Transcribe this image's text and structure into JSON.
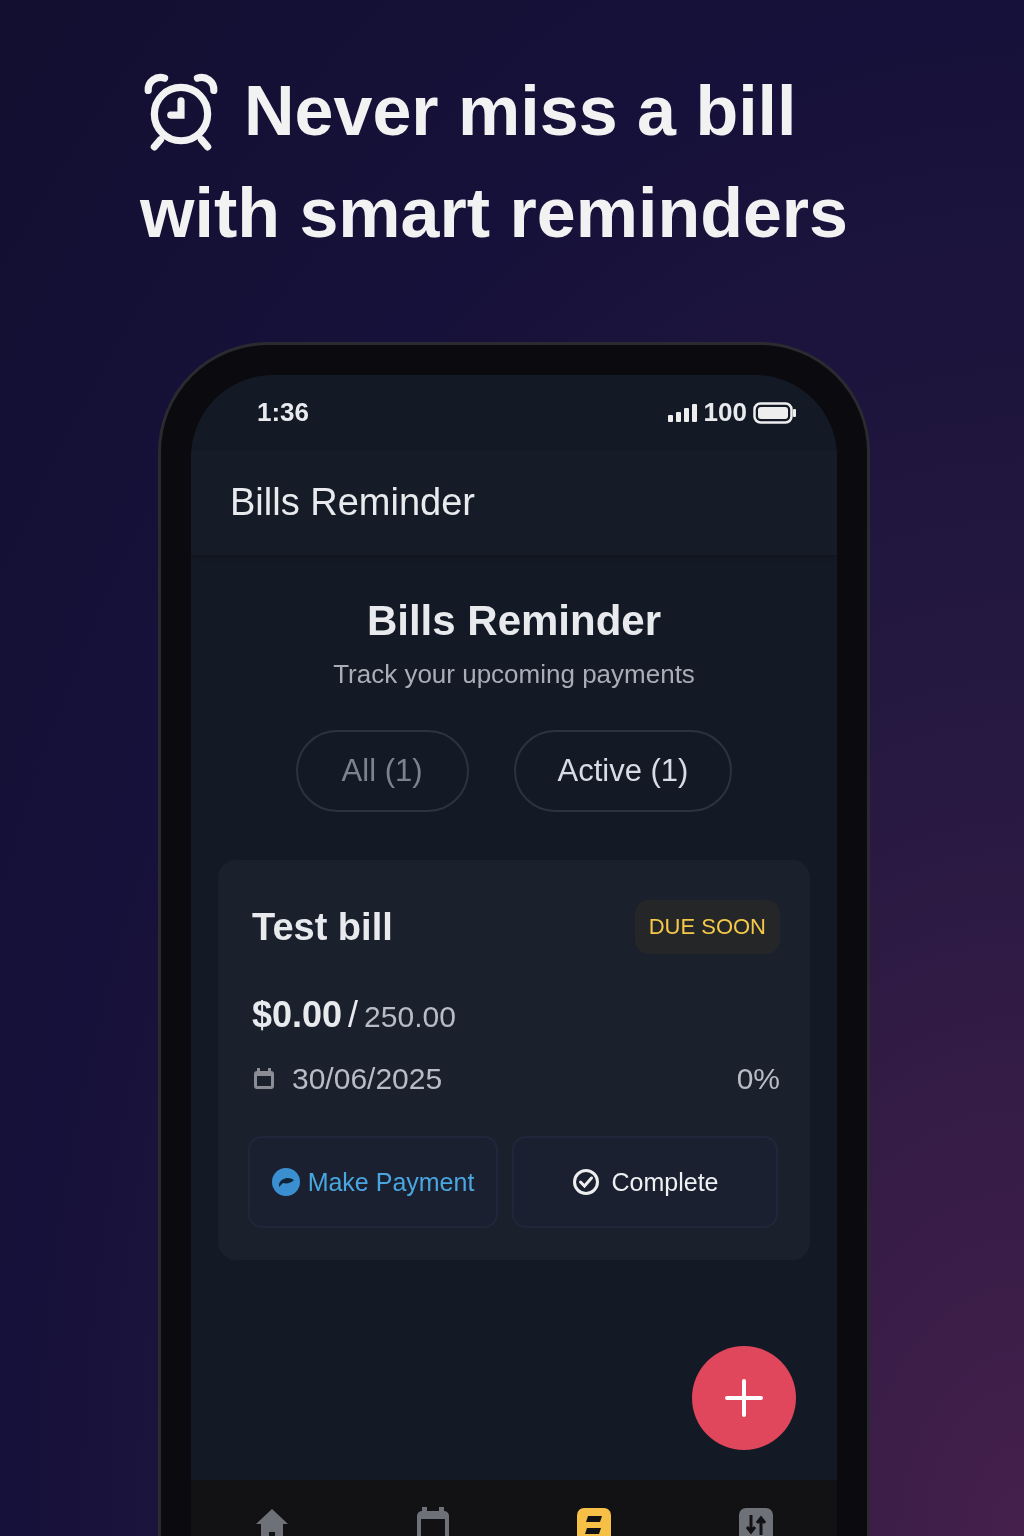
{
  "headline": [
    "Never miss a bill",
    "with smart reminders"
  ],
  "status_bar": {
    "time": "1:36",
    "battery": "100"
  },
  "app_bar": {
    "title": "Bills Reminder"
  },
  "header": {
    "title": "Bills Reminder",
    "subtitle": "Track your upcoming payments"
  },
  "filters": [
    {
      "label": "All (1)",
      "selected": false
    },
    {
      "label": "Active (1)",
      "selected": true
    }
  ],
  "bills": [
    {
      "name": "Test bill",
      "badge": "DUE SOON",
      "paid": "$0.00",
      "separator": "/",
      "total": "250.00",
      "due_date": "30/06/2025",
      "percent": "0%",
      "actions": [
        {
          "kind": "payment",
          "label": "Make Payment"
        },
        {
          "kind": "complete",
          "label": "Complete"
        }
      ]
    }
  ],
  "tab_bar": [
    {
      "kind": "home",
      "selected": false
    },
    {
      "kind": "calendar",
      "selected": false
    },
    {
      "kind": "bills",
      "selected": true
    },
    {
      "kind": "transfers",
      "selected": false
    }
  ]
}
